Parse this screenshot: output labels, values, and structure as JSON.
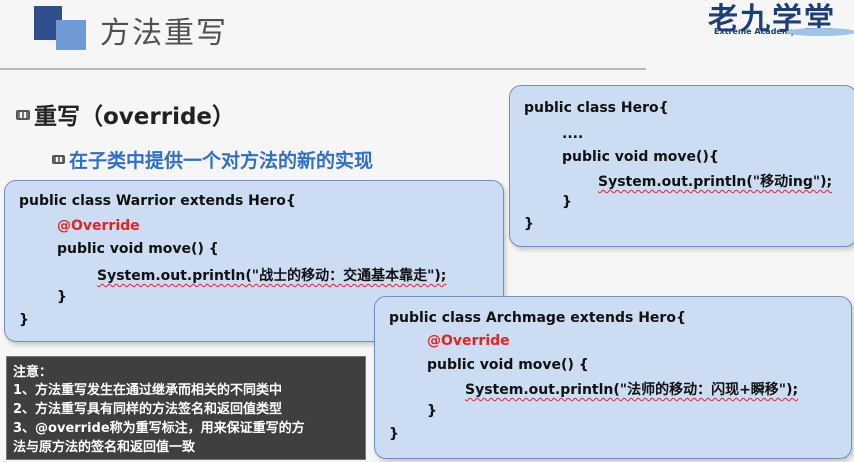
{
  "header": {
    "title": "方法重写",
    "logo": {
      "name": "老九学堂",
      "subtitle": "Extreme Academy"
    }
  },
  "heading": "重写（override）",
  "subheading": "在子类中提供一个对方法的新的实现",
  "hero_code": {
    "lines": [
      "public class Hero{",
      "....",
      "public void move(){",
      "System.out.println(\"移动ing\");",
      "}",
      "}"
    ]
  },
  "warrior_code": {
    "lines": [
      "public class Warrior extends Hero{",
      "@Override",
      "public void move() {",
      "System.out.println(\"战士的移动：交通基本靠走\");",
      "}",
      "}"
    ]
  },
  "archmage_code": {
    "lines": [
      "public class Archmage extends Hero{",
      "@Override",
      "public void move() {",
      "System.out.println(\"法师的移动：闪现+瞬移\");",
      "}",
      "}"
    ]
  },
  "note": {
    "lines": [
      "注意：",
      "1、方法重写发生在通过继承而相关的不同类中",
      "2、方法重写具有同样的方法签名和返回值类型",
      "3、@override称为重写标注，用来保证重写的方",
      "法与原方法的签名和返回值一致"
    ]
  },
  "colors": {
    "accent_blue": "#2f6fc4",
    "annotation_red": "#e02424",
    "code_box_bg": "#ccdcf2",
    "note_bg": "#3f3f3f"
  }
}
